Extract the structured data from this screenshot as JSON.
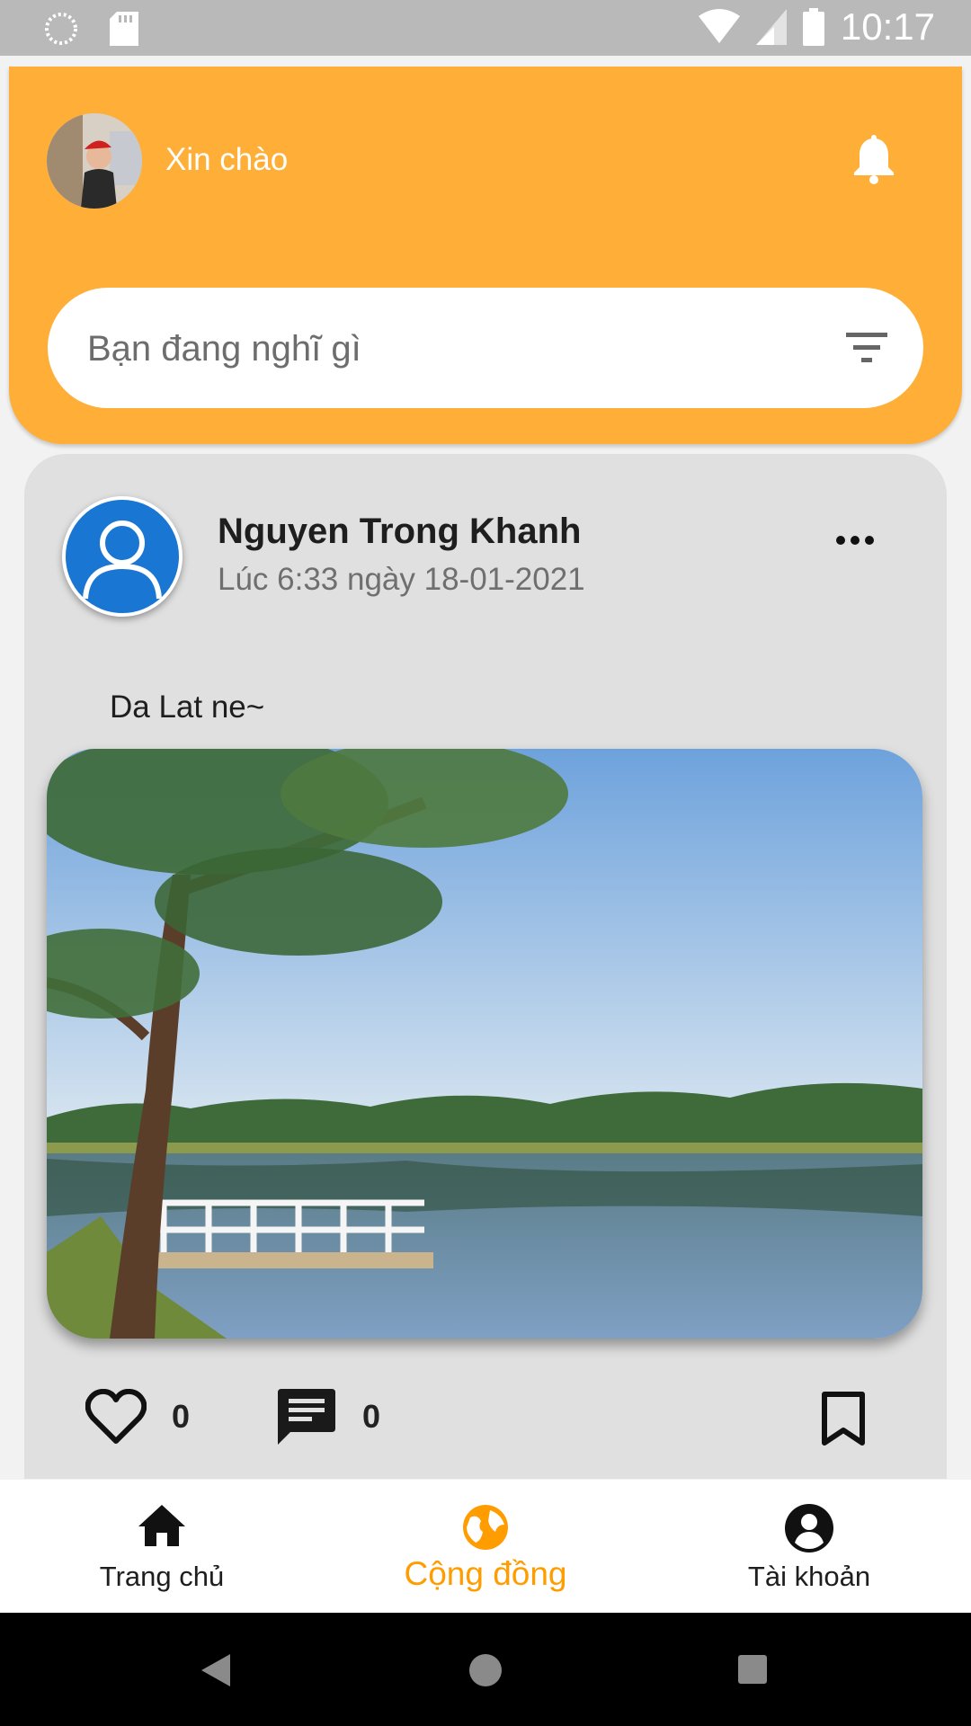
{
  "status_bar": {
    "time": "10:17"
  },
  "header": {
    "greeting": "Xin chào",
    "search_placeholder": "Bạn đang nghĩ gì"
  },
  "post": {
    "author": "Nguyen Trong Khanh",
    "timestamp": "Lúc 6:33 ngày 18-01-2021",
    "text": "Da Lat ne~",
    "like_count": "0",
    "comment_count": "0"
  },
  "bottom_nav": {
    "items": [
      {
        "label": "Trang chủ",
        "icon": "home-icon"
      },
      {
        "label": "Cộng đồng",
        "icon": "globe-icon",
        "active": true
      },
      {
        "label": "Tài khoản",
        "icon": "account-circle-icon"
      }
    ]
  },
  "colors": {
    "accent": "#ffaf38",
    "active_nav": "#ff9d00",
    "avatar_blue": "#1976d2"
  }
}
